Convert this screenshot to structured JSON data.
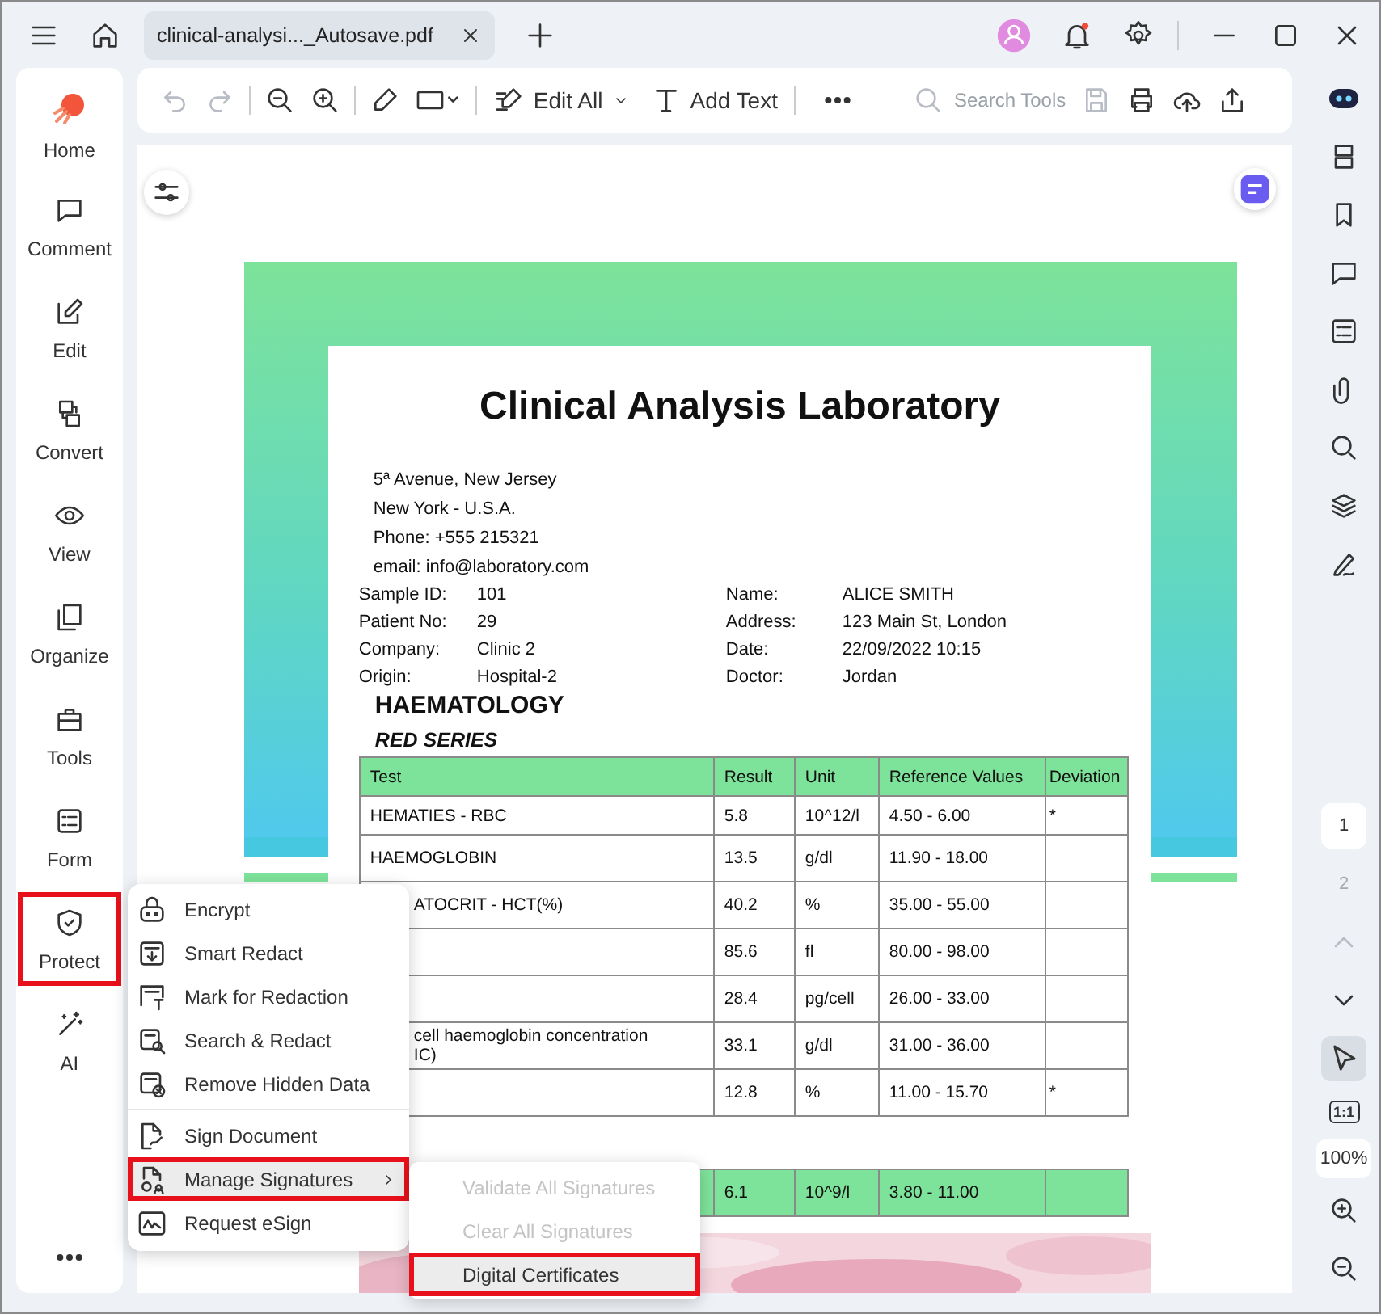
{
  "window": {
    "tab_title": "clinical-analysi..._Autosave.pdf"
  },
  "sidebar": {
    "items": [
      {
        "label": "Home",
        "selected": false
      },
      {
        "label": "Comment",
        "selected": false
      },
      {
        "label": "Edit",
        "selected": false
      },
      {
        "label": "Convert",
        "selected": false
      },
      {
        "label": "View",
        "selected": false
      },
      {
        "label": "Organize",
        "selected": false
      },
      {
        "label": "Tools",
        "selected": false
      },
      {
        "label": "Form",
        "selected": false
      },
      {
        "label": "Protect",
        "selected": true
      },
      {
        "label": "AI",
        "selected": false
      }
    ]
  },
  "toolbar": {
    "undo_disabled": true,
    "redo_disabled": true,
    "edit_label": "Edit All",
    "add_text_label": "Add Text",
    "search": {
      "placeholder": "Search Tools"
    }
  },
  "document": {
    "title": "Clinical Analysis Laboratory",
    "address": [
      "5ª Avenue, New Jersey",
      "New York - U.S.A.",
      "Phone: +555 215321",
      "email: info@laboratory.com"
    ],
    "info_rows": [
      {
        "label_1": "Sample ID:",
        "value_1": "101",
        "label_2": "Name:",
        "value_2": "ALICE SMITH"
      },
      {
        "label_1": "Patient No:",
        "value_1": "29",
        "label_2": "Address:",
        "value_2": "123 Main St, London"
      },
      {
        "label_1": "Company:",
        "value_1": "Clinic 2",
        "label_2": "Date:",
        "value_2": "22/09/2022 10:15"
      },
      {
        "label_1": "Origin:",
        "value_1": "Hospital-2",
        "label_2": "Doctor:",
        "value_2": "Jordan"
      }
    ],
    "section": "HAEMATOLOGY",
    "subsection": "RED SERIES",
    "table": {
      "columns": [
        "Test",
        "Result",
        "Unit",
        "Reference Values",
        "Deviation"
      ],
      "rows": [
        {
          "test": "HEMATIES - RBC",
          "result": "5.8",
          "unit": "10^12/l",
          "reference": "4.50 - 6.00",
          "deviation": "*"
        },
        {
          "test": "HAEMOGLOBIN",
          "result": "13.5",
          "unit": "g/dl",
          "reference": "11.90 - 18.00"
        },
        {
          "test": "ATOCRIT - HCT(%)",
          "result": "40.2",
          "unit": "%",
          "reference": "35.00 - 55.00"
        },
        {
          "result": "85.6",
          "unit": "fl",
          "reference": "80.00 - 98.00"
        },
        {
          "result": "28.4",
          "unit": "pg/cell",
          "reference": "26.00 - 33.00"
        },
        {
          "test": "cell haemoglobin concentration\nIC)",
          "result": "33.1",
          "unit": "g/dl",
          "reference": "31.00 - 36.00"
        },
        {
          "result": "12.8",
          "unit": "%",
          "reference": "11.00 - 15.70",
          "deviation": "*"
        }
      ]
    },
    "white_series_row": {
      "result": "6.1",
      "unit": "10^9/l",
      "reference": "3.80 - 11.00"
    }
  },
  "protect_menu": {
    "groups": [
      [
        {
          "label": "Encrypt",
          "selected": false
        },
        {
          "label": "Smart Redact",
          "selected": false
        },
        {
          "label": "Mark for Redaction",
          "selected": false
        },
        {
          "label": "Search & Redact",
          "selected": false
        },
        {
          "label": "Remove Hidden Data",
          "selected": false
        }
      ],
      [
        {
          "label": "Sign Document",
          "selected": false
        },
        {
          "label": "Manage Signatures",
          "selected": true,
          "has_submenu": true
        },
        {
          "label": "Request eSign",
          "selected": false
        }
      ]
    ],
    "submenu": [
      {
        "label": "Validate All Signatures",
        "disabled": true,
        "selected": false
      },
      {
        "label": "Clear All Signatures",
        "disabled": true,
        "selected": false
      },
      {
        "label": "Digital Certificates",
        "disabled": false,
        "selected": true
      }
    ]
  },
  "right_rail": {
    "pages": [
      {
        "label": "1",
        "selected": true
      },
      {
        "label": "2",
        "selected": false
      }
    ],
    "page_up_disabled": true,
    "pointer_selected": true,
    "actual_size_label": "1:1",
    "zoom": "100%"
  }
}
